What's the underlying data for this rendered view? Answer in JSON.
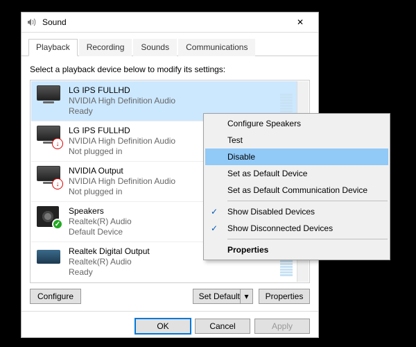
{
  "dialog": {
    "title": "Sound",
    "close": "✕"
  },
  "tabs": [
    {
      "label": "Playback",
      "active": true
    },
    {
      "label": "Recording",
      "active": false
    },
    {
      "label": "Sounds",
      "active": false
    },
    {
      "label": "Communications",
      "active": false
    }
  ],
  "instruction": "Select a playback device below to modify its settings:",
  "devices": [
    {
      "name": "LG IPS FULLHD",
      "driver": "NVIDIA High Definition Audio",
      "state": "Ready",
      "icon": "monitor",
      "badge": "",
      "selected": true,
      "vu": true
    },
    {
      "name": "LG IPS FULLHD",
      "driver": "NVIDIA High Definition Audio",
      "state": "Not plugged in",
      "icon": "monitor",
      "badge": "red",
      "selected": false,
      "vu": false
    },
    {
      "name": "NVIDIA Output",
      "driver": "NVIDIA High Definition Audio",
      "state": "Not plugged in",
      "icon": "monitor",
      "badge": "red",
      "selected": false,
      "vu": false
    },
    {
      "name": "Speakers",
      "driver": "Realtek(R) Audio",
      "state": "Default Device",
      "icon": "speaker",
      "badge": "green",
      "selected": false,
      "vu": false
    },
    {
      "name": "Realtek Digital Output",
      "driver": "Realtek(R) Audio",
      "state": "Ready",
      "icon": "digital",
      "badge": "",
      "selected": false,
      "vu": true
    }
  ],
  "buttons": {
    "configure": "Configure",
    "setdefault": "Set Default",
    "properties": "Properties",
    "ok": "OK",
    "cancel": "Cancel",
    "apply": "Apply"
  },
  "context_menu": [
    {
      "label": "Configure Speakers",
      "hl": false,
      "check": false,
      "sep": false
    },
    {
      "label": "Test",
      "hl": false,
      "check": false,
      "sep": false
    },
    {
      "label": "Disable",
      "hl": true,
      "check": false,
      "sep": false
    },
    {
      "label": "Set as Default Device",
      "hl": false,
      "check": false,
      "sep": false
    },
    {
      "label": "Set as Default Communication Device",
      "hl": false,
      "check": false,
      "sep": true
    },
    {
      "label": "Show Disabled Devices",
      "hl": false,
      "check": true,
      "sep": false
    },
    {
      "label": "Show Disconnected Devices",
      "hl": false,
      "check": true,
      "sep": true
    },
    {
      "label": "Properties",
      "hl": false,
      "check": false,
      "bold": true,
      "sep": false
    }
  ]
}
